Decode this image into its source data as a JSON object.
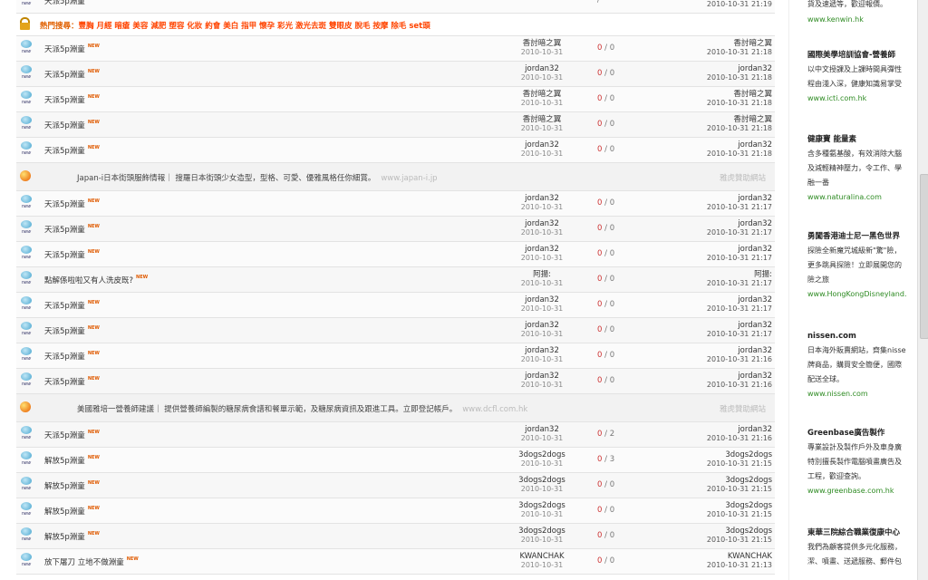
{
  "top_row": {
    "title": "天派5p淵童",
    "new": "NEW",
    "author": "jordan32",
    "author_date": "2010-10-31",
    "stats_r": "0",
    "stats_v": "0",
    "last_user": "jordan32",
    "last_time": "2010-10-31 21:19"
  },
  "top_right_text": "貨及速遞等，歡迎報價。",
  "hot": {
    "label": "熱門搜尋：",
    "keywords": "豐胸 月經 暗瘡 美容 減肥 塑容 化妝 約會 美白 指甲 懷孕 彩光 激光去斑 雙眼皮 脫毛 按摩 除毛 set頭"
  },
  "group1": [
    {
      "title": "天派5p淵童",
      "author": "香討暗之翼",
      "date": "2010-10-31",
      "r": "0",
      "v": "0",
      "last_user": "香討暗之翼",
      "last_time": "2010-10-31 21:18"
    },
    {
      "title": "天派5p淵童",
      "author": "jordan32",
      "date": "2010-10-31",
      "r": "0",
      "v": "0",
      "last_user": "jordan32",
      "last_time": "2010-10-31 21:18"
    },
    {
      "title": "天派5p淵童",
      "author": "香討暗之翼",
      "date": "2010-10-31",
      "r": "0",
      "v": "0",
      "last_user": "香討暗之翼",
      "last_time": "2010-10-31 21:18"
    },
    {
      "title": "天派5p淵童",
      "author": "香討暗之翼",
      "date": "2010-10-31",
      "r": "0",
      "v": "0",
      "last_user": "香討暗之翼",
      "last_time": "2010-10-31 21:18"
    },
    {
      "title": "天派5p淵童",
      "author": "jordan32",
      "date": "2010-10-31",
      "r": "0",
      "v": "0",
      "last_user": "jordan32",
      "last_time": "2010-10-31 21:18"
    }
  ],
  "ad1": {
    "text": "Japan-i日本街頭服飾情報｜ 搜羅日本街頭少女造型，型格、可愛、優雅風格任你細賞。",
    "url": "www.japan-i.jp",
    "sponsor": "雅虎贊助網站"
  },
  "group2": [
    {
      "title": "天派5p淵童",
      "author": "jordan32",
      "date": "2010-10-31",
      "r": "0",
      "v": "0",
      "last_user": "jordan32",
      "last_time": "2010-10-31 21:17"
    },
    {
      "title": "天派5p淵童",
      "author": "jordan32",
      "date": "2010-10-31",
      "r": "0",
      "v": "0",
      "last_user": "jordan32",
      "last_time": "2010-10-31 21:17"
    },
    {
      "title": "天派5p淵童",
      "author": "jordan32",
      "date": "2010-10-31",
      "r": "0",
      "v": "0",
      "last_user": "jordan32",
      "last_time": "2010-10-31 21:17"
    },
    {
      "title": "點解係啦啦又有人洗皮既?",
      "author": "阿揚:",
      "date": "2010-10-31",
      "r": "0",
      "v": "0",
      "last_user": "阿揚:",
      "last_time": "2010-10-31 21:17"
    },
    {
      "title": "天派5p淵童",
      "author": "jordan32",
      "date": "2010-10-31",
      "r": "0",
      "v": "0",
      "last_user": "jordan32",
      "last_time": "2010-10-31 21:17"
    },
    {
      "title": "天派5p淵童",
      "author": "jordan32",
      "date": "2010-10-31",
      "r": "0",
      "v": "0",
      "last_user": "jordan32",
      "last_time": "2010-10-31 21:17"
    },
    {
      "title": "天派5p淵童",
      "author": "jordan32",
      "date": "2010-10-31",
      "r": "0",
      "v": "0",
      "last_user": "jordan32",
      "last_time": "2010-10-31 21:16"
    },
    {
      "title": "天派5p淵童",
      "author": "jordan32",
      "date": "2010-10-31",
      "r": "0",
      "v": "0",
      "last_user": "jordan32",
      "last_time": "2010-10-31 21:16"
    }
  ],
  "ad2": {
    "text": "美國雅培一營養師建議｜ 提供營養師編製的糖尿病食譜和餐單示範，及糖尿病資訊及跟進工具。立即登記帳戶。",
    "url": "www.dcfl.com.hk",
    "sponsor": "雅虎贊助網站"
  },
  "group3": [
    {
      "title": "天派5p淵童",
      "author": "jordan32",
      "date": "2010-10-31",
      "r": "0",
      "v": "2",
      "last_user": "jordan32",
      "last_time": "2010-10-31 21:16"
    },
    {
      "title": "解放5p淵童",
      "author": "3dogs2dogs",
      "date": "2010-10-31",
      "r": "0",
      "v": "3",
      "last_user": "3dogs2dogs",
      "last_time": "2010-10-31 21:15"
    },
    {
      "title": "解放5p淵童",
      "author": "3dogs2dogs",
      "date": "2010-10-31",
      "r": "0",
      "v": "0",
      "last_user": "3dogs2dogs",
      "last_time": "2010-10-31 21:15"
    },
    {
      "title": "解放5p淵童",
      "author": "3dogs2dogs",
      "date": "2010-10-31",
      "r": "0",
      "v": "0",
      "last_user": "3dogs2dogs",
      "last_time": "2010-10-31 21:15"
    },
    {
      "title": "解放5p淵童",
      "author": "3dogs2dogs",
      "date": "2010-10-31",
      "r": "0",
      "v": "0",
      "last_user": "3dogs2dogs",
      "last_time": "2010-10-31 21:15"
    },
    {
      "title": "放下屠刀 立地不做淵童",
      "author": "KWANCHAK",
      "date": "2010-10-31",
      "r": "0",
      "v": "0",
      "last_user": "KWANCHAK",
      "last_time": "2010-10-31 21:13"
    }
  ],
  "sidebar": [
    {
      "title": "",
      "desc": "",
      "url": "www.kenwin.hk"
    },
    {
      "title": "國際美學培訓協會-營養師",
      "desc": "以中文授課及上課時間具彈性|程由淺入深，健康知識易掌受",
      "url": "www.icti.com.hk"
    },
    {
      "title": "健康寶 能量素",
      "desc": "含多種氨基酸，有效消除大腦|及減輕精神壓力，令工作、學|融一番",
      "url": "www.naturalina.com"
    },
    {
      "title": "勇闖香港迪士尼一黑色世界",
      "desc": "探險全新魔咒城級新\"驚\"險，|更多跳具探險！立即展開您的|險之旅",
      "url": "www.HongKongDisneyland."
    },
    {
      "title": "nissen.com",
      "desc": "日本海外販賣網站，齊集nisse|牌商品，購買安全簡便，國際|配送全球。",
      "url": "www.nissen.com"
    },
    {
      "title": "Greenbase廣告製作",
      "desc": "專業設計及製作戶外及車身廣|特別擅長製作電腦噴畫廣告及|工程，歡迎查詢。",
      "url": "www.greenbase.com.hk"
    },
    {
      "title": "東華三院綜合職業復康中心",
      "desc": "我們為顧客提供多元化服務，|潔、噴畫、送遞服務、郵件包|",
      "url": ""
    }
  ],
  "new_badge": "NEW",
  "icon_label": "new"
}
